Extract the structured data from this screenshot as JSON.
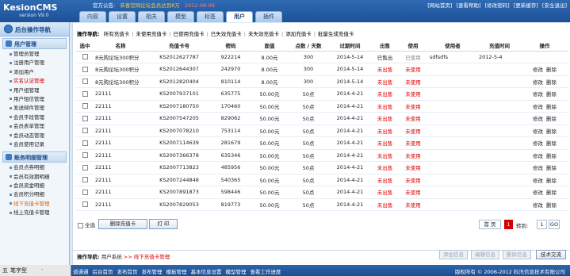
{
  "brand": {
    "title": "KesionCMS",
    "version": "version V9.0"
  },
  "notice": {
    "label": "官方公告:",
    "text": "恭喜官网论坛会员达到8万",
    "date": "2012-08-09"
  },
  "toplinks": [
    "[网站首页]",
    "[查看帮助]",
    "[修改密码]",
    "[更新缓存]",
    "[安全退出]"
  ],
  "tabs": [
    "内容",
    "设置",
    "相关",
    "模型",
    "标签",
    "用户",
    "插件"
  ],
  "active_tab": "用户",
  "sidebar": {
    "header": "后台操作导航",
    "sections": [
      {
        "title": "用户管理",
        "items": [
          {
            "label": "管理员管理",
            "style": ""
          },
          {
            "label": "注册用户管理",
            "style": ""
          },
          {
            "label": "添加用户",
            "style": ""
          },
          {
            "label": "实名认证管理",
            "style": "red"
          },
          {
            "label": "用户组管理",
            "style": ""
          },
          {
            "label": "用户短信管理",
            "style": ""
          },
          {
            "label": "发送邮件管理",
            "style": ""
          },
          {
            "label": "会员字段管理",
            "style": ""
          },
          {
            "label": "会员表单管理",
            "style": ""
          },
          {
            "label": "会员动态管理",
            "style": ""
          },
          {
            "label": "会员使用记录",
            "style": ""
          }
        ]
      },
      {
        "title": "账务明细管理",
        "items": [
          {
            "label": "会员点券明细",
            "style": ""
          },
          {
            "label": "会员有效期明细",
            "style": ""
          },
          {
            "label": "会员资金明细",
            "style": ""
          },
          {
            "label": "会员积分明细",
            "style": ""
          },
          {
            "label": "线下充值卡管理",
            "style": "orange"
          },
          {
            "label": "线上充值卡管理",
            "style": ""
          }
        ]
      }
    ]
  },
  "opnav": {
    "label": "操作导航:",
    "links": [
      "所有充值卡",
      "未使用充值卡",
      "已使用充值卡",
      "已失效充值卡",
      "未失效充值卡",
      "添加充值卡",
      "批量生成充值卡"
    ]
  },
  "table": {
    "columns": [
      "选中",
      "名称",
      "充值卡号",
      "密码",
      "面值",
      "点数 / 天数",
      "过期时间",
      "出售",
      "使用",
      "使用者",
      "充值时间",
      "操作"
    ],
    "rows": [
      {
        "name": "8元购论坛300积分",
        "card": "KS2012627787",
        "pwd": "922214",
        "face": "8.00元",
        "points": "300",
        "expire": "2014-5-14",
        "sold": "已售出",
        "used": "已使用",
        "user": "sdfsdfs",
        "time": "2012-5-4",
        "ops": []
      },
      {
        "name": "8元购论坛300积分",
        "card": "KS2012644307",
        "pwd": "242970",
        "face": "8.00元",
        "points": "300",
        "expire": "2014-5-14",
        "sold": "未出售",
        "used": "未使用",
        "user": "",
        "time": "",
        "ops": [
          "修改",
          "删除"
        ]
      },
      {
        "name": "8元购论坛300积分",
        "card": "KS2012820404",
        "pwd": "810114",
        "face": "8.00元",
        "points": "300",
        "expire": "2014-5-14",
        "sold": "未出售",
        "used": "未使用",
        "user": "",
        "time": "",
        "ops": [
          "修改",
          "删除"
        ]
      },
      {
        "name": "22111",
        "card": "KS2007937101",
        "pwd": "635775",
        "face": "50.00元",
        "points": "50点",
        "expire": "2014-4-21",
        "sold": "未出售",
        "used": "未使用",
        "user": "",
        "time": "",
        "ops": [
          "修改",
          "删除"
        ]
      },
      {
        "name": "22111",
        "card": "KS2007180750",
        "pwd": "170460",
        "face": "50.00元",
        "points": "50点",
        "expire": "2014-4-21",
        "sold": "未出售",
        "used": "未使用",
        "user": "",
        "time": "",
        "ops": [
          "修改",
          "删除"
        ]
      },
      {
        "name": "22111",
        "card": "KS2007547205",
        "pwd": "829062",
        "face": "50.00元",
        "points": "50点",
        "expire": "2014-4-21",
        "sold": "未出售",
        "used": "未使用",
        "user": "",
        "time": "",
        "ops": [
          "修改",
          "删除"
        ]
      },
      {
        "name": "22111",
        "card": "KS2007078210",
        "pwd": "753114",
        "face": "50.00元",
        "points": "50点",
        "expire": "2014-4-21",
        "sold": "未出售",
        "used": "未使用",
        "user": "",
        "time": "",
        "ops": [
          "修改",
          "删除"
        ]
      },
      {
        "name": "22111",
        "card": "KS2007114639",
        "pwd": "281679",
        "face": "50.00元",
        "points": "50点",
        "expire": "2014-4-21",
        "sold": "未出售",
        "used": "未使用",
        "user": "",
        "time": "",
        "ops": [
          "修改",
          "删除"
        ]
      },
      {
        "name": "22111",
        "card": "KS2007366378",
        "pwd": "635346",
        "face": "50.00元",
        "points": "50点",
        "expire": "2014-4-21",
        "sold": "未出售",
        "used": "未使用",
        "user": "",
        "time": "",
        "ops": [
          "修改",
          "删除"
        ]
      },
      {
        "name": "22111",
        "card": "KS2007713823",
        "pwd": "485956",
        "face": "50.00元",
        "points": "50点",
        "expire": "2014-4-21",
        "sold": "未出售",
        "used": "未使用",
        "user": "",
        "time": "",
        "ops": [
          "修改",
          "删除"
        ]
      },
      {
        "name": "22111",
        "card": "KS2007244848",
        "pwd": "540365",
        "face": "50.00元",
        "points": "50点",
        "expire": "2014-4-21",
        "sold": "未出售",
        "used": "未使用",
        "user": "",
        "time": "",
        "ops": [
          "修改",
          "删除"
        ]
      },
      {
        "name": "22111",
        "card": "KS2007891873",
        "pwd": "598446",
        "face": "50.00元",
        "points": "50点",
        "expire": "2014-4-21",
        "sold": "未出售",
        "used": "未使用",
        "user": "",
        "time": "",
        "ops": [
          "修改",
          "删除"
        ]
      },
      {
        "name": "22111",
        "card": "KS2007829053",
        "pwd": "819773",
        "face": "50.00元",
        "points": "50点",
        "expire": "2014-4-21",
        "sold": "未出售",
        "used": "未使用",
        "user": "",
        "time": "",
        "ops": [
          "修改",
          "删除"
        ]
      }
    ]
  },
  "controls": {
    "select_all": "全选",
    "delete_btn": "删除充值卡",
    "print_btn": "打 印",
    "pager": {
      "first": "首 页",
      "current": "1",
      "goto": "转到:",
      "page_value": "1",
      "go": "GO"
    }
  },
  "bottom_nav": {
    "label": "操作导航:",
    "path": "用户系统",
    "arrow": ">>",
    "current": "线下充值卡管理"
  },
  "bottom_buttons": [
    "添加信息",
    "编辑信息",
    "删除信息",
    "技术交流"
  ],
  "statusbar": {
    "ime": [
      "五",
      "笔字型",
      "·"
    ],
    "links": [
      "道通通",
      "后台首页",
      "发布首页",
      "发布管理",
      "模板管理",
      "基本信息设置",
      "模型管理",
      "查看工作进度"
    ],
    "copyright": "版权所有 © 2006-2012 科汛信息技术有限公司"
  },
  "colors": {
    "header": "#1d5196",
    "accent_red": "#e00000",
    "sidebar_bg": "#f1f6fb"
  }
}
